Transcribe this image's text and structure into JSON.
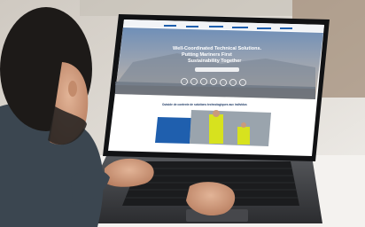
{
  "photo": {
    "subject": "man using laptop",
    "website": {
      "hero_headline_line1": "Well-Coordinated Technical Solutions.",
      "hero_headline_line2": "Putting Mariners First",
      "hero_headline_line3": "Sustainability Together",
      "section_heading": "Outside de contexte de solutions technologiques aux individus"
    }
  },
  "colors": {
    "laptop_body": "#3a3b3e",
    "screen_bezel": "#111214",
    "hero_sky": "#8aa3c4",
    "website_accent": "#1f5fae",
    "hivis_jacket": "#d7e21e",
    "wall": "#d7d2cb",
    "shirt": "#3b4650",
    "hair": "#1d1a18"
  }
}
